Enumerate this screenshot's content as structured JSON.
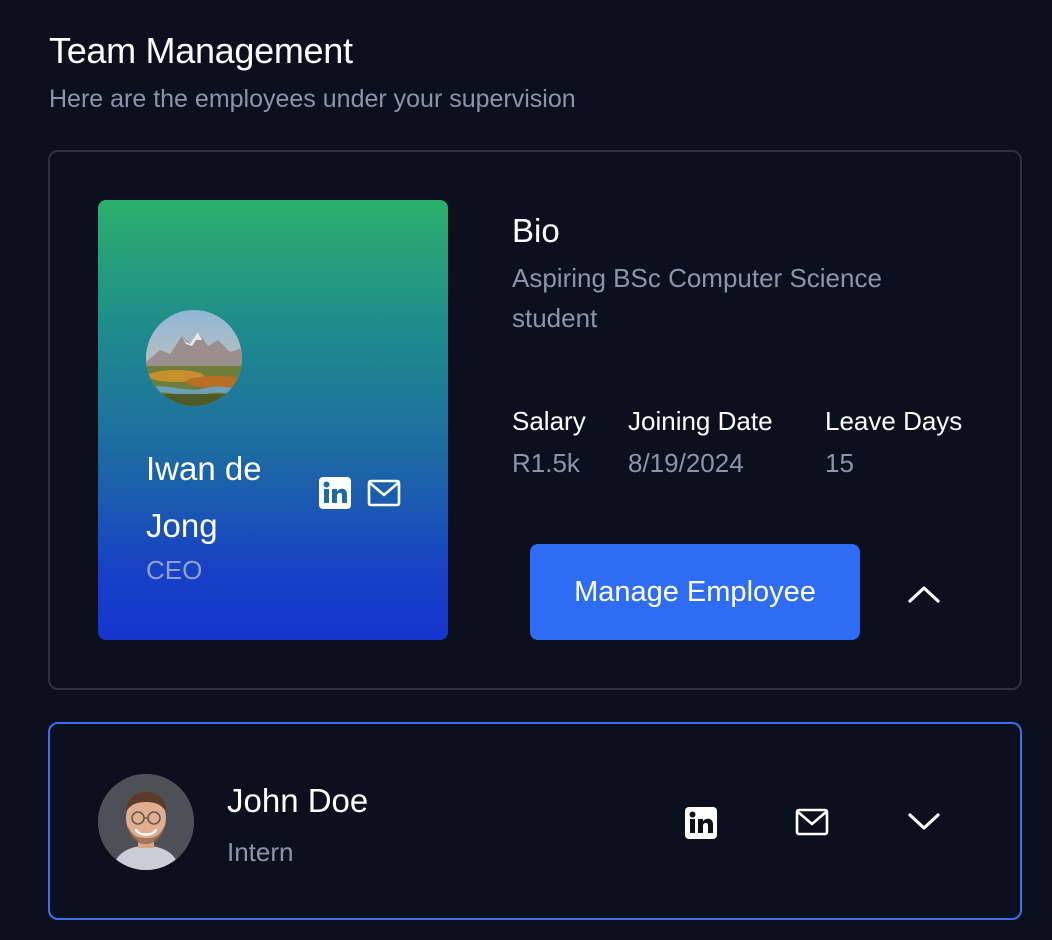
{
  "header": {
    "title": "Team Management",
    "subtitle": "Here are the employees under your supervision"
  },
  "employees": [
    {
      "name": "Iwan de Jong",
      "role": "CEO",
      "expanded": true,
      "bio_heading": "Bio",
      "bio": "Aspiring BSc Computer Science student",
      "stats": [
        {
          "label": "Salary",
          "value": "R1.5k"
        },
        {
          "label": "Joining Date",
          "value": "8/19/2024"
        },
        {
          "label": "Leave Days",
          "value": "15"
        }
      ],
      "manage_label": "Manage Employee",
      "icons": [
        "linkedin-icon",
        "mail-icon",
        "chevron-up-icon"
      ]
    },
    {
      "name": "John Doe",
      "role": "Intern",
      "expanded": false,
      "icons": [
        "linkedin-icon",
        "mail-icon",
        "chevron-down-icon"
      ]
    }
  ],
  "colors": {
    "background": "#0b101f",
    "card_border": "#2b3141",
    "selected_border": "#3b6ff0",
    "primary_button": "#2f6cf4",
    "muted_text": "#8b95aa",
    "gradient_top": "#2bb06b",
    "gradient_bottom": "#1535cf"
  }
}
